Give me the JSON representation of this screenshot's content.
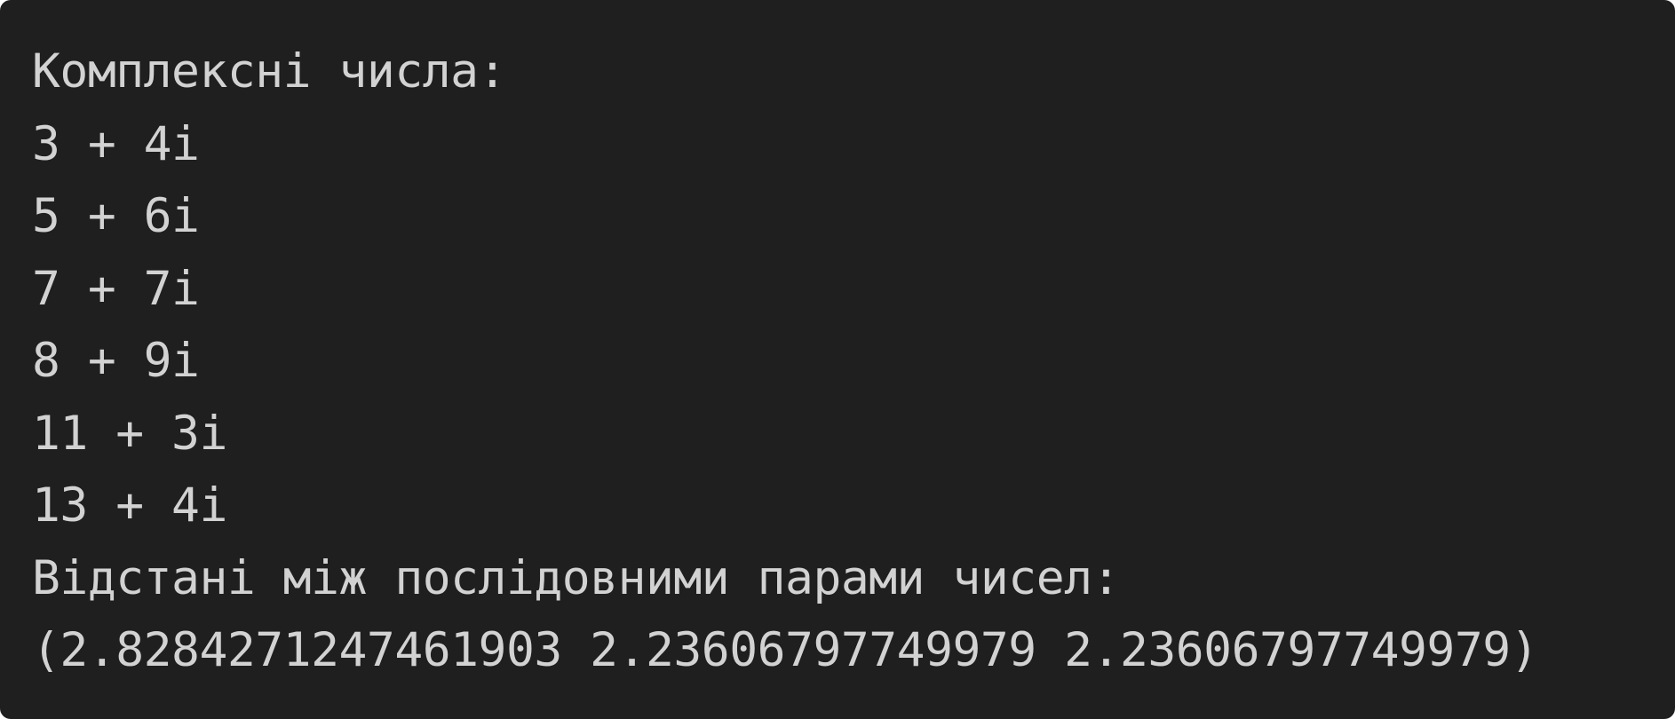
{
  "console": {
    "header": "Комплексні числа:",
    "numbers": [
      "3 + 4i",
      "5 + 6i",
      "7 + 7i",
      "8 + 9i",
      "11 + 3i",
      "13 + 4i"
    ],
    "distances_header": "Відстані між послідовними парами чисел:",
    "distances_output": "(2.8284271247461903 2.23606797749979 2.23606797749979)"
  },
  "colors": {
    "background": "#1f1f1f",
    "text": "#d2d2d2"
  }
}
